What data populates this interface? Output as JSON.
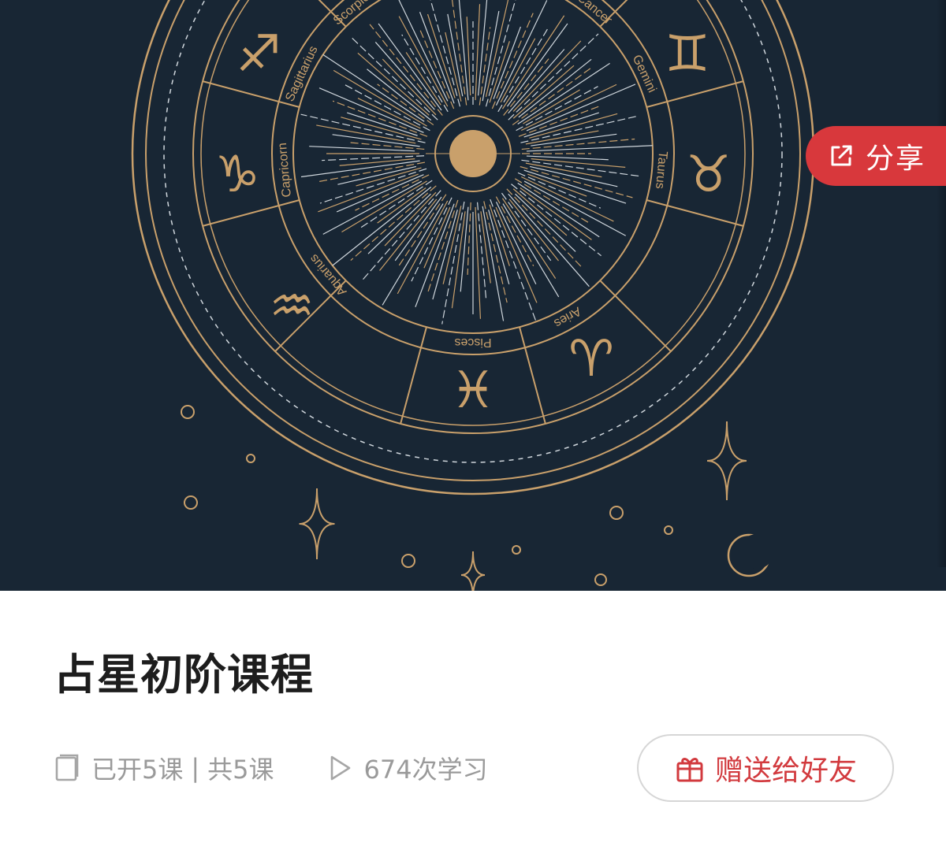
{
  "cover": {
    "zodiac_labels": [
      "Scorpio",
      "Cancer",
      "Sagittarius",
      "Gemini",
      "Capricorn",
      "Taurus",
      "Aquarius",
      "Aries",
      "Pisces"
    ],
    "zodiac_glyphs": [
      "♏",
      "♋",
      "♐",
      "♊",
      "♑",
      "♉",
      "♒",
      "♈",
      "♓"
    ],
    "gold_color": "#c9a06b",
    "background_color": "#182634"
  },
  "share": {
    "label": "分享",
    "icon": "share-icon",
    "color": "#d8383c"
  },
  "course": {
    "title": "占星初阶课程",
    "opened_lessons": "已开5课",
    "separator": "|",
    "total_lessons": "共5课",
    "study_count": "674次学习",
    "lessons_icon": "book-icon",
    "study_icon": "play-icon"
  },
  "gift_button": {
    "label": "赠送给好友",
    "icon": "gift-icon",
    "color": "#d23a3e"
  }
}
